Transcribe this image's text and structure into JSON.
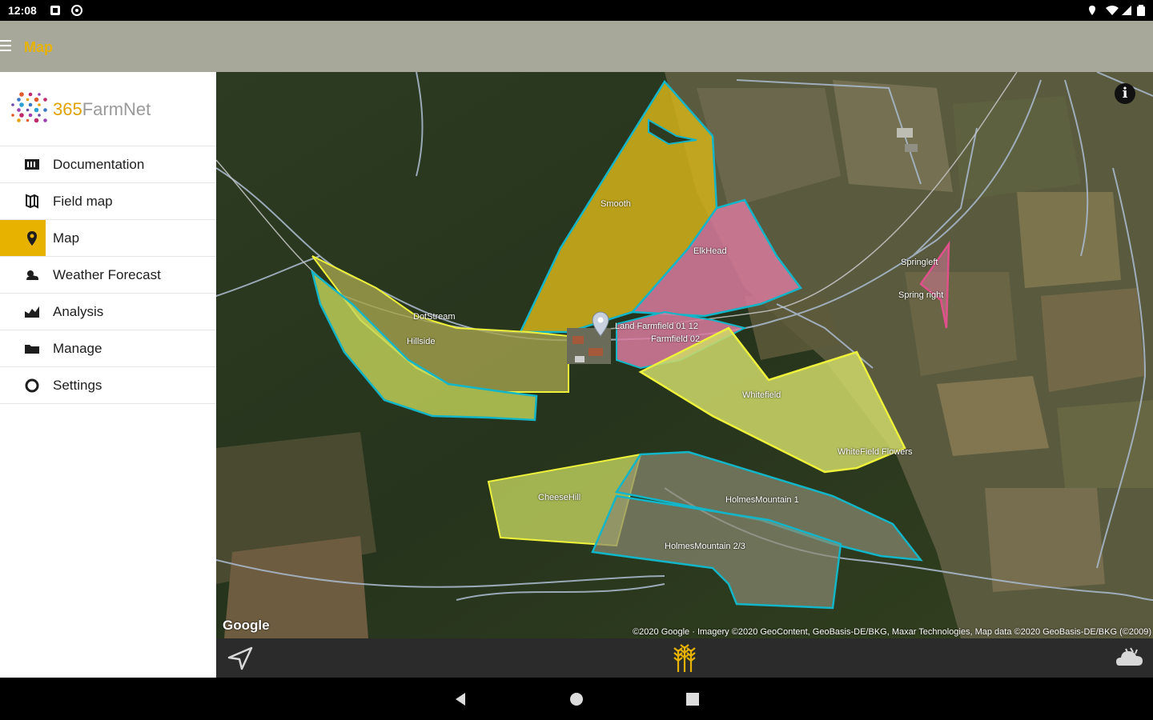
{
  "status_bar": {
    "time": "12:08",
    "icons": [
      "notification-square-icon",
      "settings-circle-icon",
      "location-icon",
      "wifi-icon",
      "signal-icon",
      "battery-icon"
    ]
  },
  "app_bar": {
    "title": "Map",
    "menu_icon": "hamburger-menu-icon"
  },
  "drawer": {
    "logo": {
      "prefix": "365",
      "suffix": "FarmNet"
    },
    "items": [
      {
        "label": "Documentation",
        "icon": "documentation-icon",
        "active": false
      },
      {
        "label": "Field map",
        "icon": "field-map-icon",
        "active": false
      },
      {
        "label": "Map",
        "icon": "map-pin-icon",
        "active": true
      },
      {
        "label": "Weather Forecast",
        "icon": "weather-icon",
        "active": false
      },
      {
        "label": "Analysis",
        "icon": "analysis-icon",
        "active": false
      },
      {
        "label": "Manage",
        "icon": "manage-icon",
        "active": false
      },
      {
        "label": "Settings",
        "icon": "settings-icon",
        "active": false
      }
    ]
  },
  "map": {
    "field_labels": {
      "smooth": "Smooth",
      "elkhead": "ElkHead",
      "springleft": "Springleft",
      "springright": "Spring right",
      "dotstream": "DotStream",
      "hillside": "Hillside",
      "farmfield1": "Land Farmfield 01 12",
      "farmfield2": "Farmfield 02",
      "whitefield": "Whitefield",
      "whitefield_flowers": "WhiteField Flowers",
      "cheesehill": "CheeseHill",
      "holmes1": "HolmesMountain 1",
      "holmes23": "HolmesMountain 2/3"
    },
    "google_logo": "Google",
    "attribution": "©2020 Google · Imagery ©2020 GeoContent, GeoBasis-DE/BKG, Maxar Technologies, Map data ©2020 GeoBasis-DE/BKG (©2009)",
    "info_button": "i",
    "colors": {
      "yellow_field": "#d4b21a",
      "pink_field": "#d97a9e",
      "lime_field": "#c6d65a",
      "outline_cyan": "#12b6c8",
      "outline_yellow": "#eef23a",
      "outline_pink": "#e0508a"
    }
  },
  "bottom_bar": {
    "icons": [
      "navigation-arrow-icon",
      "crop-icon",
      "weather-cloud-icon"
    ],
    "accent": "#e8b300"
  },
  "nav_bar": {
    "icons": [
      "back-icon",
      "home-icon",
      "recents-icon"
    ]
  }
}
